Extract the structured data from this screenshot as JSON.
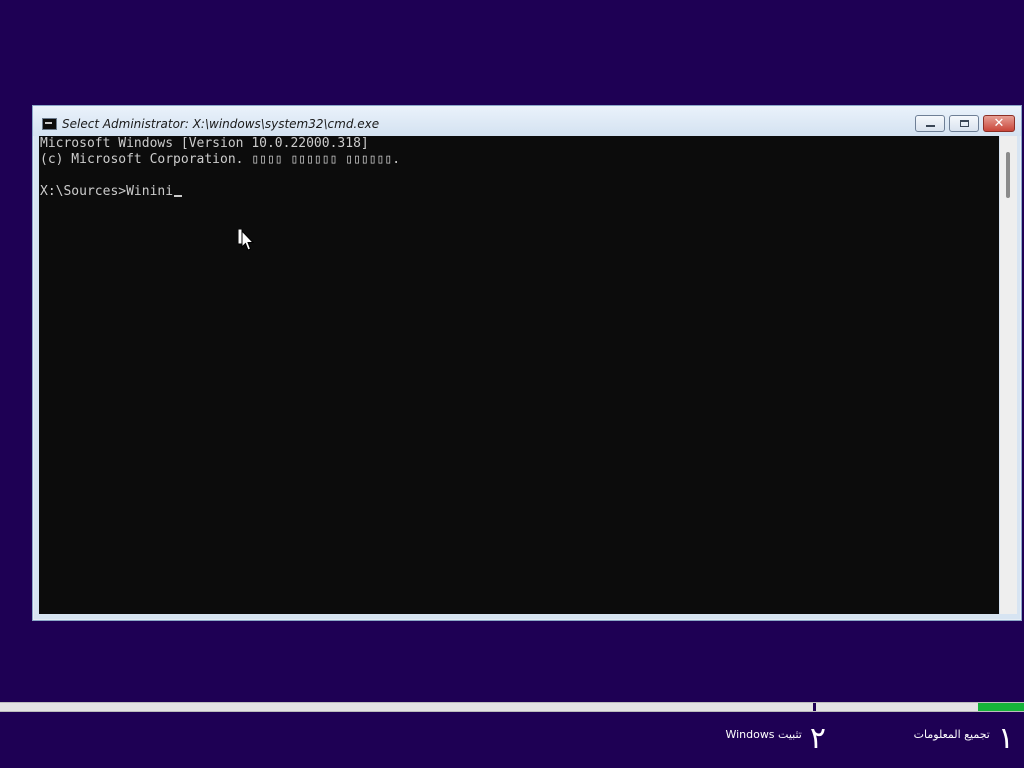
{
  "window": {
    "title": "Select Administrator: X:\\windows\\system32\\cmd.exe",
    "icon": "cmd-icon",
    "controls": {
      "minimize_icon": "minimize-icon",
      "maximize_icon": "maximize-icon",
      "close_label": "✕"
    }
  },
  "console": {
    "lines": [
      "Microsoft Windows [Version 10.0.22000.318]",
      "(c) Microsoft Corporation. ▯▯▯▯ ▯▯▯▯▯▯ ▯▯▯▯▯▯.",
      "",
      "X:\\Sources>Winini"
    ],
    "background": "#0c0c0c",
    "foreground": "#cccccc"
  },
  "setup": {
    "progress_fraction": 0.045,
    "progress_color": "#16b33a",
    "steps": [
      {
        "number": "١",
        "label": "تجميع المعلومات"
      },
      {
        "number": "٢",
        "label": "تثبيت Windows"
      }
    ]
  },
  "colors": {
    "desktop_background": "#1e0054"
  }
}
